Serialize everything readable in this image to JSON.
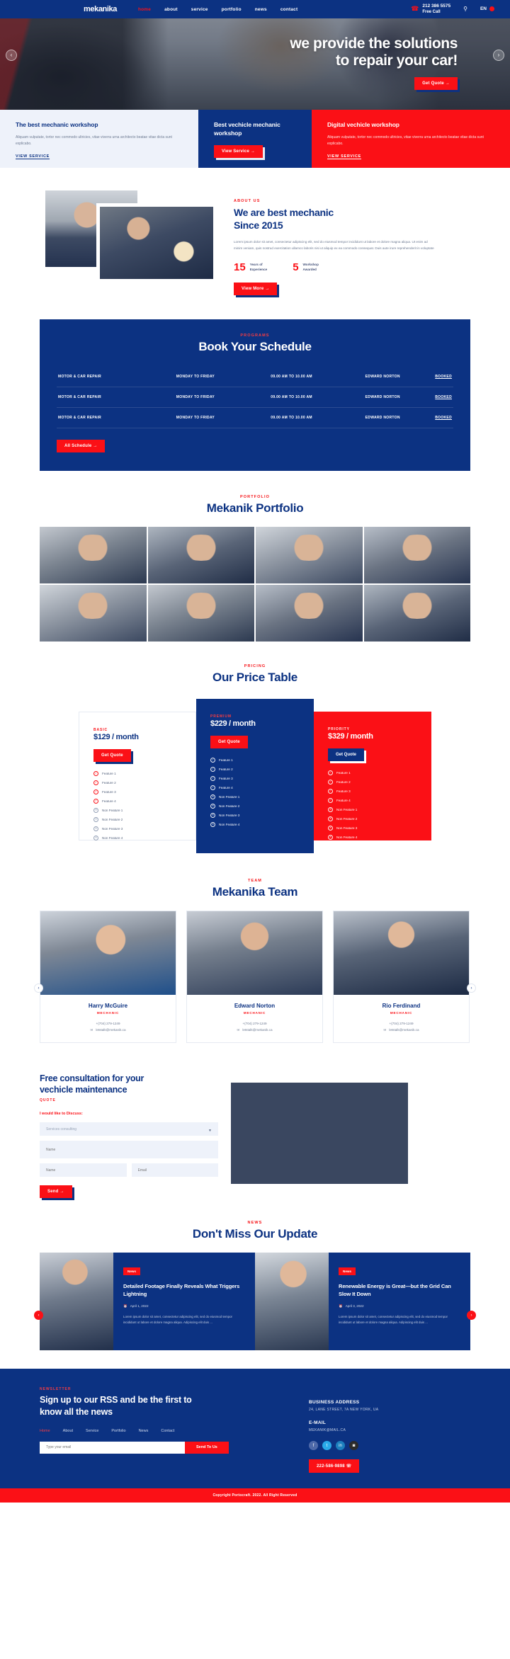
{
  "header": {
    "logo": "mekanika",
    "nav": [
      {
        "label": "home",
        "active": true
      },
      {
        "label": "about",
        "active": false
      },
      {
        "label": "service",
        "active": false
      },
      {
        "label": "portfolio",
        "active": false
      },
      {
        "label": "news",
        "active": false
      },
      {
        "label": "contact",
        "active": false
      }
    ],
    "phone_number": "212 386 5575",
    "phone_sub": "Free Call",
    "phone_icon": "phone-icon",
    "search_icon": "search-icon",
    "language": "EN"
  },
  "hero": {
    "title_line1": "we provide the solutions",
    "title_line2": "to repair your car!",
    "cta": "Get Quote  →",
    "prev_icon": "chevron-left-icon",
    "next_icon": "chevron-right-icon"
  },
  "features": [
    {
      "title": "The best mechanic workshop",
      "body": "Aliquam vulputate, tortor nec commodo ultricies, vitae viverra urna architecto beatae vitae dicta sunt explicabo.",
      "link": "VIEW SERVICE"
    },
    {
      "title": "Best vechicle mechanic workshop",
      "button": "View Service  →"
    },
    {
      "title": "Digital vechicle workshop",
      "body": "Aliquam vulputate, tortor nec commodo ultricies, vitae viverra urna architecto beatae vitae dicta sunt explicabo.",
      "link": "VIEW SERVICE"
    }
  ],
  "about": {
    "label": "ABOUT US",
    "title_line1": "We are best mechanic",
    "title_line2": "Since 2015",
    "body": "Lorem ipsum dolor sit amet, consectetur adipiscing elit, sed do eiusmod tempor incididunt ut labore et dolore magna aliqua. Ut enim ad minim veniam, quis nostrud exercitation ullamco laboris nisi ut aliquip ex ea commodo consequat. Duis aute irure reprehenderit in voluptate",
    "stats": [
      {
        "number": "15",
        "line1": "Years of",
        "line2": "Experience"
      },
      {
        "number": "5",
        "line1": "Workshop",
        "line2": "Awarded"
      }
    ],
    "button": "View More  →"
  },
  "schedule": {
    "label": "PROGRAMS",
    "title": "Book Your Schedule",
    "rows": [
      {
        "service": "MOTOR & CAR REPAIR",
        "days": "MONDAY TO FRIDAY",
        "time": "09.00 AM TO 10.00 AM",
        "person": "EDWARD NORTON",
        "status": "BOOKED"
      },
      {
        "service": "MOTOR & CAR REPAIR",
        "days": "MONDAY TO FRIDAY",
        "time": "09.00 AM TO 10.00 AM",
        "person": "EDWARD NORTON",
        "status": "BOOKED"
      },
      {
        "service": "MOTOR & CAR REPAIR",
        "days": "MONDAY TO FRIDAY",
        "time": "09.00 AM TO 10.00 AM",
        "person": "EDWARD NORTON",
        "status": "BOOKED"
      }
    ],
    "button": "All Schedule  →"
  },
  "portfolio": {
    "label": "PORTFOLIO",
    "title": "Mekanik Portfolio"
  },
  "pricing": {
    "label": "PRICING",
    "title": "Our Price Table",
    "plans": [
      {
        "tier": "BASIC",
        "price": "$129 / month",
        "button": "Get Quote",
        "features": [
          "Feature 1",
          "Feature 2",
          "Feature 3",
          "Feature 4"
        ],
        "non_features": [
          "Non Feature 1",
          "Non Feature 2",
          "Non Feature 3",
          "Non Feature 4"
        ]
      },
      {
        "tier": "PREMIUM",
        "price": "$229 / month",
        "button": "Get Quote",
        "features": [
          "Feature 1",
          "Feature 2",
          "Feature 3",
          "Feature 4"
        ],
        "non_features": [
          "Non Feature 1",
          "Non Feature 2",
          "Non Feature 3",
          "Non Feature 4"
        ]
      },
      {
        "tier": "PRIORITY",
        "price": "$329 / month",
        "button": "Get Quote",
        "features": [
          "Feature 1",
          "Feature 2",
          "Feature 3",
          "Feature 4"
        ],
        "non_features": [
          "Non Feature 1",
          "Non Feature 2",
          "Non Feature 3",
          "Non Feature 4"
        ]
      }
    ]
  },
  "team": {
    "label": "TEAM",
    "title": "Mekanika Team",
    "members": [
      {
        "name": "Harry McGuire",
        "role": "MECHANIC",
        "phone": "+(704) 279-1249",
        "email": "letstalk@mekanik.ca"
      },
      {
        "name": "Edward Norton",
        "role": "MECHANIC",
        "phone": "+(704) 279-1249",
        "email": "letstalk@mekanik.ca"
      },
      {
        "name": "Rio Ferdinand",
        "role": "MECHANIC",
        "phone": "+(704) 279-1249",
        "email": "letstalk@mekanik.ca"
      }
    ],
    "prev_icon": "chevron-left-icon",
    "next_icon": "chevron-right-icon"
  },
  "consult": {
    "title_line1": "Free consultation for your",
    "title_line2": "vechicle maintenance",
    "label": "QUOTE",
    "field_label": "I would like to Discuss:",
    "select_value": "Services consulting",
    "message_placeholder": "Name",
    "name_placeholder": "Name",
    "email_placeholder": "Email",
    "button": "Send  →"
  },
  "news": {
    "label": "NEWS",
    "title": "Don't Miss Our Update",
    "posts": [
      {
        "badge": "News",
        "title": "Detailed Footage Finally Reveals What Triggers Lightning",
        "date": "April 1, 2022",
        "excerpt": "Lorem ipsum dolor sit amet, consectetur adipiscing elit, sed do eiusmod tempor incididunt ut labore et dolore magna aliqua. Adipiscing elit duis ..."
      },
      {
        "badge": "News",
        "title": "Renewable Energy is Great—but the Grid Can Slow It Down",
        "date": "April 3, 2022",
        "excerpt": "Lorem ipsum dolor sit amet, consectetur adipiscing elit, sed do eiusmod tempor incididunt ut labore et dolore magna aliqua. Adipiscing elit duis ..."
      }
    ],
    "prev_icon": "chevron-left-icon",
    "next_icon": "chevron-right-icon"
  },
  "footer": {
    "label": "NEWSLETTER",
    "title_line1": "Sign up to our RSS and be the first to",
    "title_line2": "know all the news",
    "nav": [
      {
        "label": "Home",
        "active": true
      },
      {
        "label": "About",
        "active": false
      },
      {
        "label": "Service",
        "active": false
      },
      {
        "label": "Portfolio",
        "active": false
      },
      {
        "label": "News",
        "active": false
      },
      {
        "label": "Contact",
        "active": false
      }
    ],
    "email_placeholder": "Type your email",
    "send_button": "Send To Us",
    "address_heading": "BUSINESS ADDRESS",
    "address_value": "24, LANE STREET, 7A NEW YORK, UA",
    "email_heading": "E-MAIL",
    "email_value": "MEKANIK@MAIL.CA",
    "socials": [
      {
        "name": "facebook-icon",
        "glyph": "f"
      },
      {
        "name": "twitter-icon",
        "glyph": "t"
      },
      {
        "name": "linkedin-icon",
        "glyph": "in"
      },
      {
        "name": "instagram-icon",
        "glyph": "◙"
      }
    ],
    "phone_button": "222-586-9898 ☏",
    "copyright": "Copyright Portocraft. 2022. All Right Reserved"
  },
  "colors": {
    "brand_blue": "#0c3282",
    "brand_red": "#fb1016",
    "light_blue_bg": "#eef2fa"
  }
}
